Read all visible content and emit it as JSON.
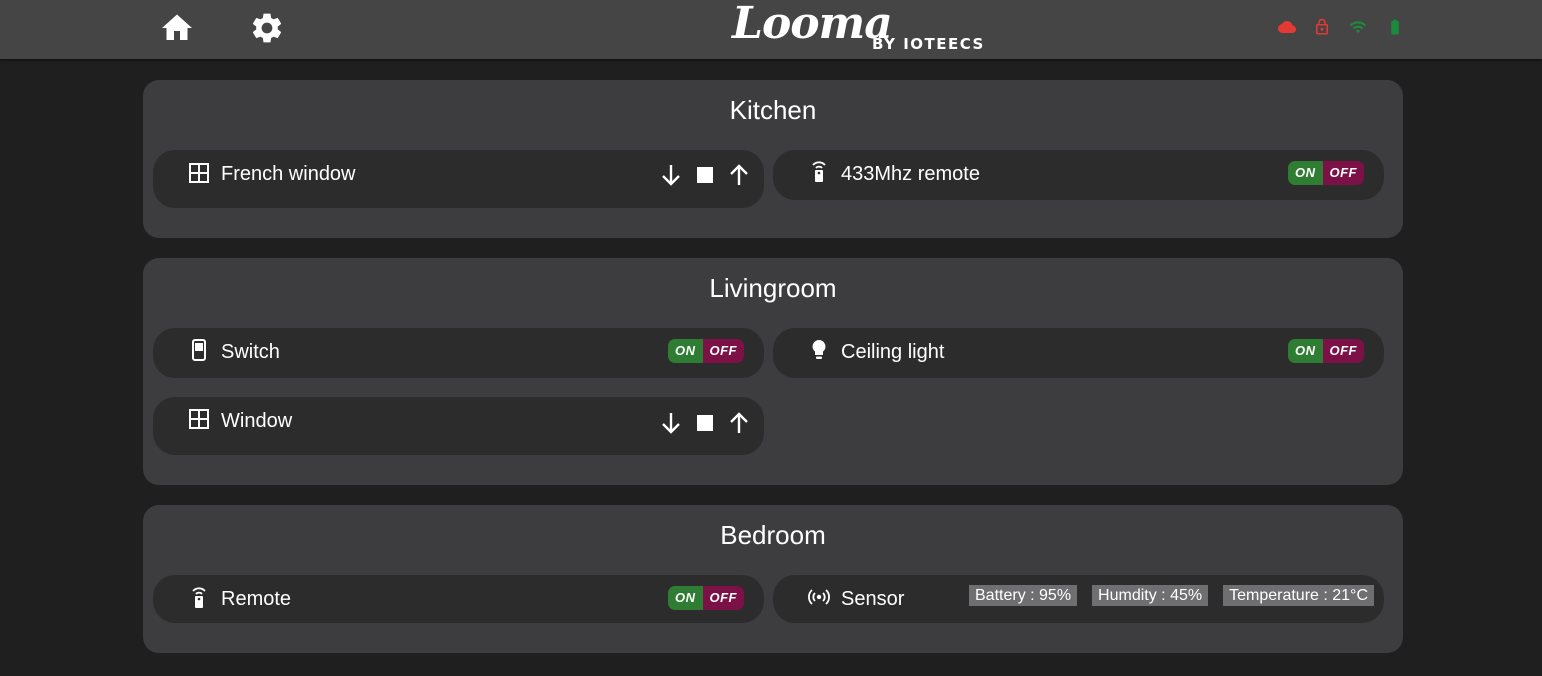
{
  "header": {
    "logo_text": "Looma",
    "logo_byline": "BY IOTEECS",
    "nav": [
      {
        "name": "home-icon",
        "label": "home"
      },
      {
        "name": "gear-icon",
        "label": "settings"
      }
    ],
    "status": [
      {
        "icon": "cloud-icon",
        "color": "#e53935"
      },
      {
        "icon": "lock-icon",
        "color": "#e53935"
      },
      {
        "icon": "wifi-icon",
        "color": "#1b8a3b"
      },
      {
        "icon": "battery-icon",
        "color": "#1b8a3b"
      }
    ]
  },
  "toggle_labels": {
    "on": "ON",
    "off": "OFF"
  },
  "rooms": [
    {
      "title": "Kitchen",
      "devices": [
        {
          "label": "French window",
          "icon": "window-icon",
          "type": "shutter"
        },
        {
          "label": "433Mhz remote",
          "icon": "remote-icon",
          "type": "toggle"
        }
      ]
    },
    {
      "title": "Livingroom",
      "devices": [
        {
          "label": "Switch",
          "icon": "switch-icon",
          "type": "toggle"
        },
        {
          "label": "Ceiling light",
          "icon": "lightbulb-icon",
          "type": "toggle"
        },
        {
          "label": "Window",
          "icon": "window-icon",
          "type": "shutter"
        }
      ]
    },
    {
      "title": "Bedroom",
      "devices": [
        {
          "label": "Remote",
          "icon": "remote-icon",
          "type": "toggle"
        },
        {
          "label": "Sensor",
          "icon": "sensor-icon",
          "type": "sensor",
          "readings": [
            "Battery : 95%",
            "Humdity : 45%",
            "Temperature : 21°C"
          ]
        }
      ]
    }
  ],
  "colors": {
    "on": "#2e7d32",
    "off": "#7b1146",
    "panel": "#3d3d40",
    "card": "#2c2c2d",
    "header": "#454546"
  }
}
